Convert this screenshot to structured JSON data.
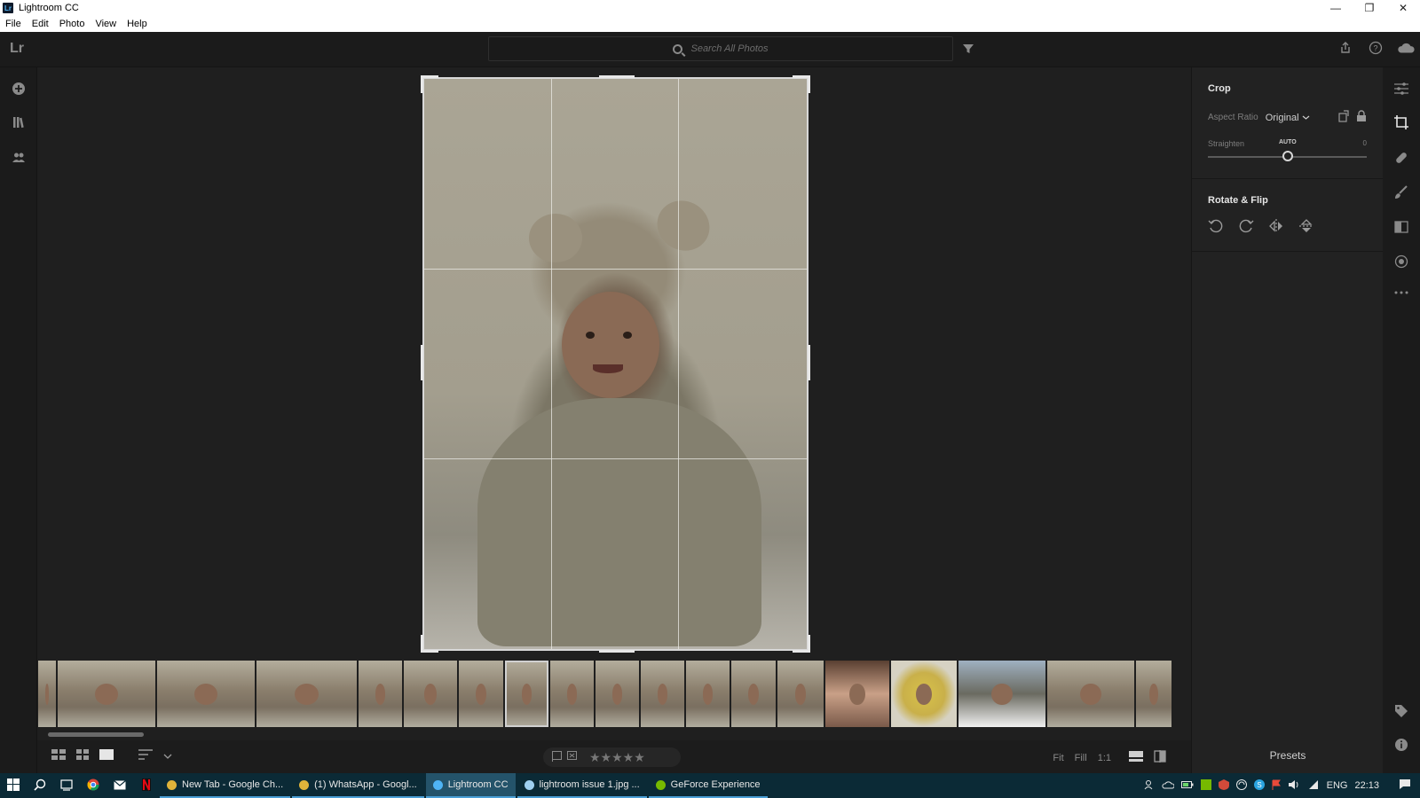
{
  "window": {
    "title": "Lightroom CC",
    "app_icon_text": "Lr",
    "minimize": "—",
    "restore": "❐",
    "close": "✕"
  },
  "menu": [
    "File",
    "Edit",
    "Photo",
    "View",
    "Help"
  ],
  "topbar": {
    "logo": "Lr",
    "search_placeholder": "Search All Photos"
  },
  "panel": {
    "crop": {
      "title": "Crop",
      "aspect_ratio_label": "Aspect Ratio",
      "aspect_ratio_value": "Original",
      "straighten_label": "Straighten",
      "straighten_auto": "AUTO",
      "straighten_value": "0",
      "straighten_fraction": 0.5
    },
    "rotate": {
      "title": "Rotate & Flip"
    },
    "presets_label": "Presets"
  },
  "filmstrip": {
    "thumb_count": 21,
    "selected_index": 8
  },
  "bottombar": {
    "fit": "Fit",
    "fill": "Fill",
    "one_to_one": "1:1",
    "stars": "★★★★★"
  },
  "taskbar": {
    "apps": [
      {
        "label": "New Tab - Google Ch...",
        "icon": "chrome-icon",
        "color": "#e0b33a",
        "active": false
      },
      {
        "label": "(1) WhatsApp - Googl...",
        "icon": "chrome-icon",
        "color": "#e0b33a",
        "active": false
      },
      {
        "label": "Lightroom CC",
        "icon": "lightroom-icon",
        "color": "#4fb4f5",
        "active": true
      },
      {
        "label": "lightroom issue 1.jpg ...",
        "icon": "photos-icon",
        "color": "#9fd0f0",
        "active": false
      },
      {
        "label": "GeForce Experience",
        "icon": "geforce-icon",
        "color": "#76b900",
        "active": false
      }
    ],
    "lang": "ENG",
    "time": "22:13"
  },
  "colors": {
    "accent": "#4a9fd6",
    "panel_bg": "#222222",
    "canvas_bg": "#1f1f1f"
  }
}
